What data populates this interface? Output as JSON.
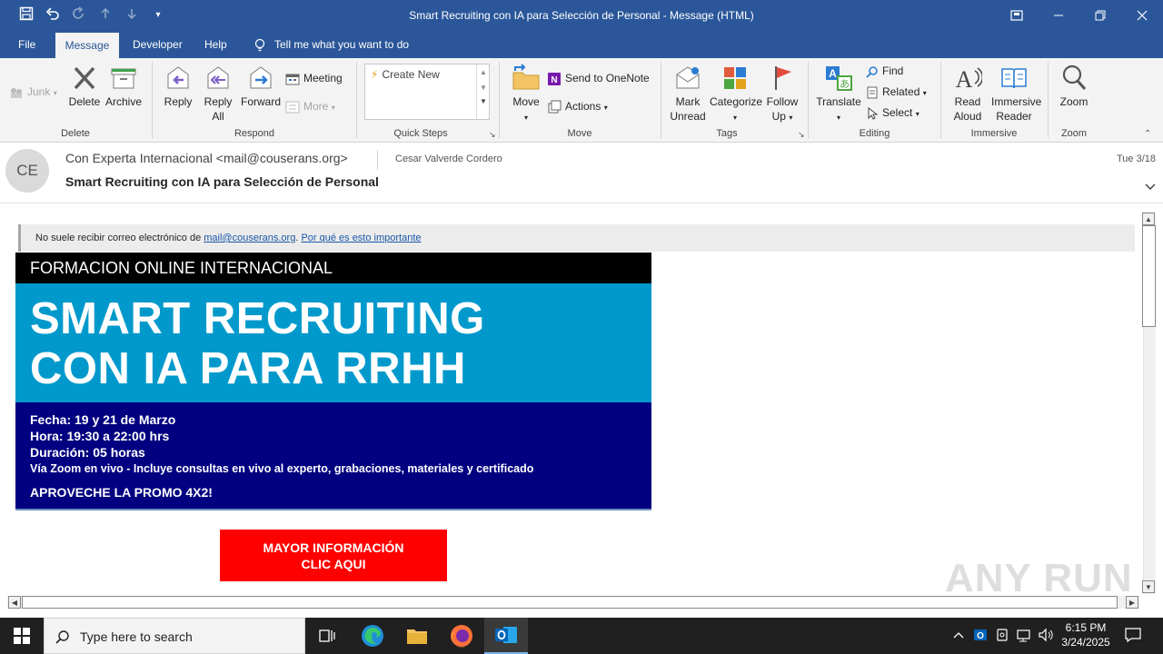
{
  "window": {
    "title": "Smart Recruiting con IA para Selección de Personal  -  Message (HTML)",
    "controls": [
      "minimize",
      "maximize",
      "close"
    ]
  },
  "menu": {
    "tabs": [
      "File",
      "Message",
      "Developer",
      "Help"
    ],
    "active": "Message",
    "tell_me": "Tell me what you want to do"
  },
  "ribbon": {
    "delete_group": {
      "label": "Delete",
      "junk": "Junk",
      "delete": "Delete",
      "archive": "Archive"
    },
    "respond_group": {
      "label": "Respond",
      "reply": "Reply",
      "reply_all_1": "Reply",
      "reply_all_2": "All",
      "forward": "Forward",
      "meeting": "Meeting",
      "more": "More"
    },
    "quicksteps_group": {
      "label": "Quick Steps",
      "create_new": "Create New"
    },
    "move_group": {
      "label": "Move",
      "move": "Move",
      "onenote": "Send to OneNote",
      "actions": "Actions"
    },
    "tags_group": {
      "label": "Tags",
      "mark_unread_1": "Mark",
      "mark_unread_2": "Unread",
      "categorize": "Categorize",
      "follow_up_1": "Follow",
      "follow_up_2": "Up"
    },
    "editing_group": {
      "label": "Editing",
      "translate": "Translate",
      "find": "Find",
      "related": "Related",
      "select": "Select"
    },
    "immersive_group": {
      "label": "Immersive",
      "read_aloud_1": "Read",
      "read_aloud_2": "Aloud",
      "immersive_reader_1": "Immersive",
      "immersive_reader_2": "Reader"
    },
    "zoom_group": {
      "label": "Zoom",
      "zoom": "Zoom"
    }
  },
  "header": {
    "avatar_initials": "CE",
    "from": "Con Experta Internacional <mail@couserans.org>",
    "to": "Cesar Valverde Cordero",
    "date": "Tue 3/18",
    "subject": "Smart Recruiting con IA para Selección de Personal"
  },
  "infobar": {
    "text": "No suele recibir correo electrónico de ",
    "email": "mail@couserans.org",
    "dot": ". ",
    "link": "Por qué es esto importante"
  },
  "email": {
    "top_banner": "FORMACION ONLINE INTERNACIONAL",
    "headline_1": "SMART RECRUITING",
    "headline_2": "CON IA PARA RRHH",
    "fecha": "Fecha: 19 y 21 de Marzo",
    "hora": "Hora: 19:30  a 22:00 hrs",
    "duracion": "Duración: 05 horas",
    "via": "Vía Zoom en vivo - Incluye consultas  en vivo al experto, grabaciones,  materiales  y certificado",
    "promo": "APROVECHE LA PROMO 4X2!",
    "cta_1": "MAYOR INFORMACIÓN",
    "cta_2": "CLIC AQUI"
  },
  "watermark": "ANY RUN",
  "taskbar": {
    "search_placeholder": "Type here to search",
    "time": "6:15 PM",
    "date": "3/24/2025"
  },
  "colors": {
    "accent": "#2b579a",
    "banner_black": "#000000",
    "banner_blue": "#0199cc",
    "banner_navy": "#010080",
    "cta_red": "#ff0000"
  }
}
